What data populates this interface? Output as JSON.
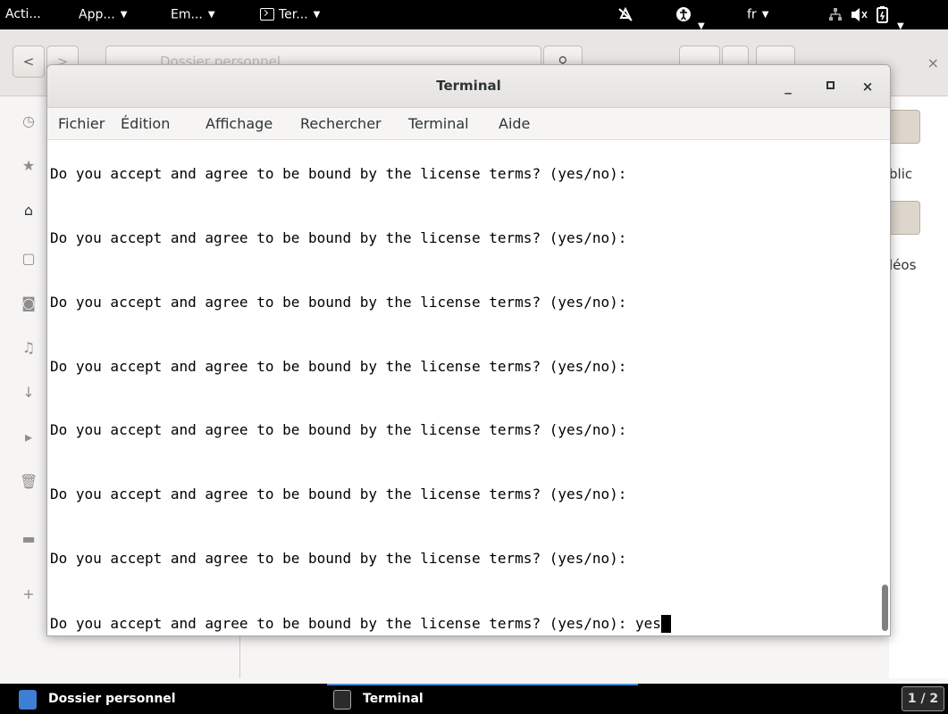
{
  "top_panel": {
    "activities": "Acti...",
    "apps": "App...",
    "places": "Em...",
    "active_app": "Ter...",
    "language": "fr",
    "icons": [
      "night-light-off-icon",
      "accessibility-icon",
      "network-icon",
      "volume-muted-icon",
      "battery-icon"
    ]
  },
  "file_manager": {
    "back_glyph": "<",
    "path_hint": "Dossier personnel",
    "close_glyph": "×",
    "folder_labels": [
      "blic",
      "léos"
    ]
  },
  "terminal": {
    "title": "Terminal",
    "menu": [
      "Fichier",
      "Édition",
      "Affichage",
      "Rechercher",
      "Terminal",
      "Aide"
    ],
    "controls": {
      "minimize": "_",
      "maximize": "□",
      "close": "×"
    },
    "prompt_text": "Do you accept and agree to be bound by the license terms? (yes/no):",
    "lines": [
      "Do you accept and agree to be bound by the license terms? (yes/no):",
      "Do you accept and agree to be bound by the license terms? (yes/no):",
      "Do you accept and agree to be bound by the license terms? (yes/no):",
      "Do you accept and agree to be bound by the license terms? (yes/no):",
      "Do you accept and agree to be bound by the license terms? (yes/no):",
      "Do you accept and agree to be bound by the license terms? (yes/no):",
      "Do you accept and agree to be bound by the license terms? (yes/no):"
    ],
    "current_input_line": "Do you accept and agree to be bound by the license terms? (yes/no): yes"
  },
  "taskbar": {
    "tasks": [
      "Dossier personnel",
      "Terminal"
    ],
    "workspace": "1 / 2"
  },
  "colors": {
    "panel_bg": "#000000",
    "accent": "#4a90d9",
    "terminal_fg": "#000000",
    "terminal_bg": "#ffffff"
  }
}
